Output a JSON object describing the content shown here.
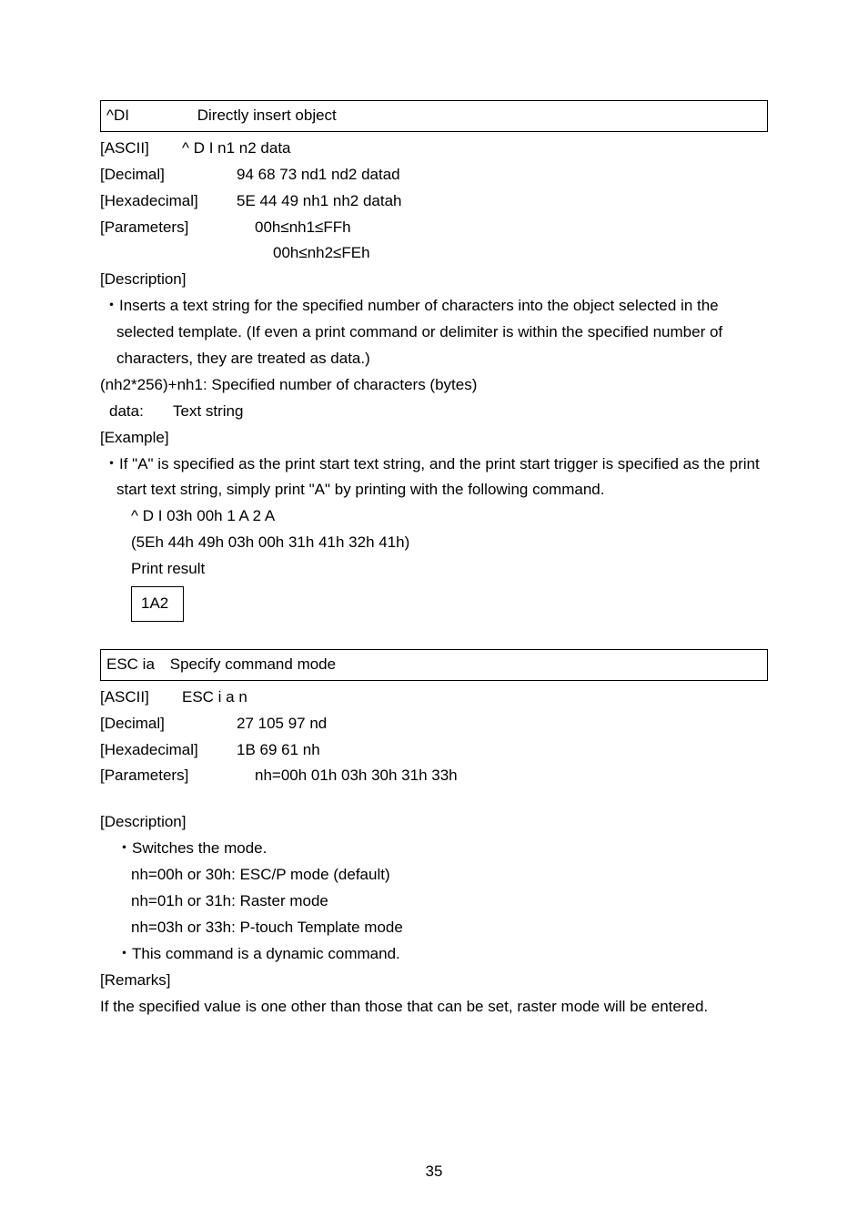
{
  "s1": {
    "box_name": "^DI",
    "box_title": "Directly insert object",
    "ascii_label": "[ASCII]",
    "ascii_val": "^   D   I   n1   n2   data",
    "decimal_label": "[Decimal]",
    "decimal_val": "94 68 73 nd1 nd2 datad",
    "hexa_label": "[Hexadecimal]",
    "hexa_val": "5E 44 49 nh1 nh2 datah",
    "param_label": "[Parameters]",
    "param_val1": "00h≤nh1≤FFh",
    "param_val2": "00h≤nh2≤FEh",
    "desc_label": "[Description]",
    "desc_bullet": "・Inserts a text string for the specified number of characters into the object selected in the selected template. (If even a print command or delimiter is within the specified number of characters, they are treated as data.)",
    "formula": "(nh2*256)+nh1: Specified number of characters (bytes)",
    "data_label": "data:",
    "data_val": "Text string",
    "example_label": "[Example]",
    "example_bullet": "・If \"A\" is specified as the print start text string, and the print start trigger is specified as the print start text string, simply print \"A\" by printing with the following command.",
    "cmd_seq": "^ D I 03h 00h 1 A 2 A",
    "hex_seq": "(5Eh 44h 49h 03h 00h 31h 41h 32h 41h)",
    "print_result_label": "Print result",
    "print_result_val": "1A2"
  },
  "s2": {
    "box_name": "ESC ia",
    "box_title": "Specify command mode",
    "ascii_label": "[ASCII]",
    "ascii_val": "ESC   i   a   n",
    "decimal_label": "[Decimal]",
    "decimal_val": "27   105 97 nd",
    "hexa_label": "[Hexadecimal]",
    "hexa_val": "1B   69   61 nh",
    "param_label": "[Parameters]",
    "param_val": "nh=00h 01h 03h 30h 31h 33h",
    "desc_label": "[Description]",
    "desc_bullet": "・Switches the mode.",
    "mode_00": "nh=00h or 30h: ESC/P mode (default)",
    "mode_01": "nh=01h or 31h: Raster mode",
    "mode_03": "nh=03h or 33h: P-touch Template mode",
    "dynamic_bullet": "・This command is a dynamic command.",
    "remarks_label": "[Remarks]",
    "remarks_text": "If the specified value is one other than those that can be set, raster mode will be entered."
  },
  "page_num": "35"
}
